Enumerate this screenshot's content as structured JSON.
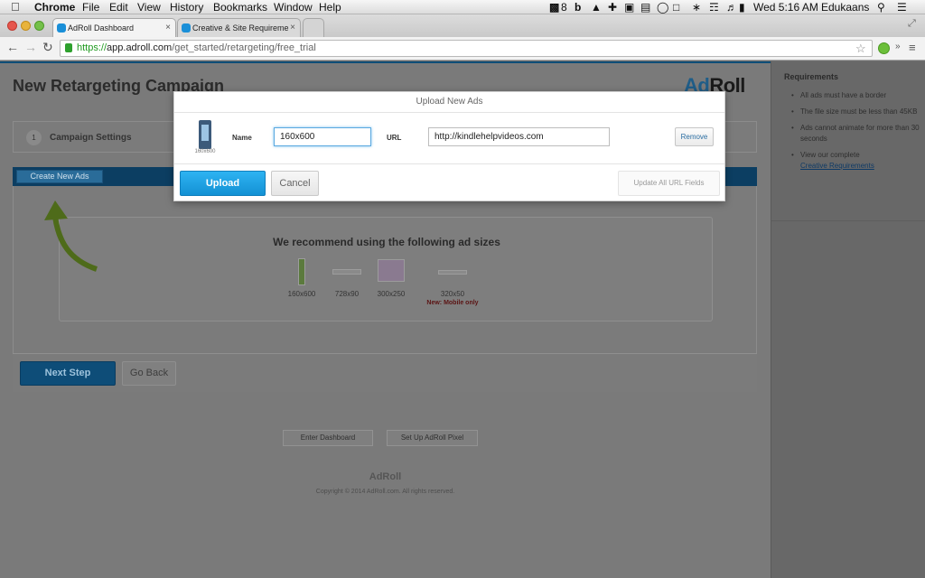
{
  "menubar": {
    "apple": "",
    "app": "Chrome",
    "items": [
      "File",
      "Edit",
      "View",
      "History",
      "Bookmarks",
      "Window",
      "Help"
    ],
    "clock": "Wed 5:16 AM",
    "user": "Edukaans",
    "adobe_count": "8"
  },
  "browser": {
    "tabs": [
      {
        "title": "AdRoll Dashboard",
        "close": "×"
      },
      {
        "title": "Creative & Site Requireme",
        "close": "×"
      }
    ],
    "url_scheme": "https://",
    "url_host": "app.adroll.com",
    "url_path": "/get_started/retargeting/free_trial"
  },
  "page": {
    "title": "New Retargeting Campaign",
    "logo_ad": "Ad",
    "logo_roll": "Roll",
    "step_number": "1",
    "step_label": "Campaign Settings",
    "create_new_ads": "Create New Ads",
    "recommend_title": "We recommend using the following ad sizes",
    "ad_sizes": [
      "160x600",
      "728x90",
      "300x250",
      "320x50"
    ],
    "mobile_note": "New: Mobile only",
    "next_step": "Next Step",
    "go_back": "Go Back",
    "enter_dashboard": "Enter Dashboard",
    "setup_pixel": "Set Up AdRoll Pixel",
    "footer_logo": "AdRoll",
    "copyright": "Copyright © 2014 AdRoll.com. All rights reserved."
  },
  "sidebar": {
    "heading": "Requirements",
    "items": [
      "All ads must have a border",
      "The file size must be less than 45KB",
      "Ads cannot animate for more than 30 seconds",
      "View our complete"
    ],
    "link": "Creative Requirements"
  },
  "modal": {
    "title": "Upload New Ads",
    "thumb_caption": "160x600",
    "name_label": "Name",
    "name_value": "160x600",
    "url_label": "URL",
    "url_value": "http://kindlehelpvideos.com",
    "remove": "Remove",
    "upload": "Upload",
    "cancel": "Cancel",
    "update_all": "Update All URL Fields"
  },
  "colors": {
    "upload_blue": "#1a9ee0",
    "overlay_gray": "#7a7a7a",
    "arrow_green": "#4e6b1a"
  }
}
